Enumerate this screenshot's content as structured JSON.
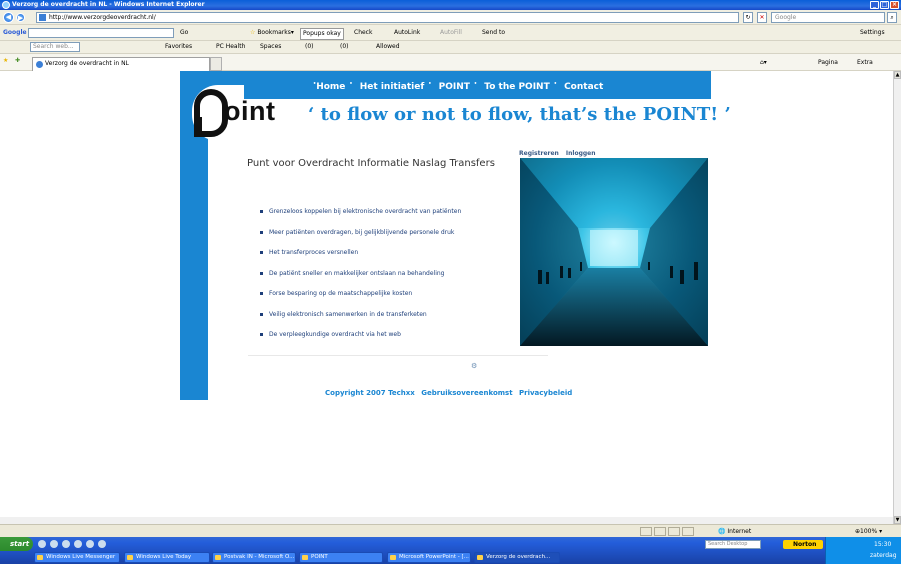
{
  "window": {
    "title": "Verzorg de overdracht in NL - Windows Internet Explorer"
  },
  "address": {
    "url": "http://www.verzorgdeoverdracht.nl/",
    "search_placeholder": "Google"
  },
  "toolbar": {
    "google": "Google",
    "search_placeholder": "Search web...",
    "go": "Go",
    "bookmarks": "Bookmarks",
    "popups": "Popups okay",
    "check": "Check",
    "autolink": "AutoLink",
    "autofill": "AutoFill",
    "sendto": "Send to",
    "settings": "Settings"
  },
  "toolbar2": {
    "search_placeholder": "Search web...",
    "favorites": "Favorites",
    "pchealth": "PC Health",
    "spaces": "Spaces",
    "mail_count": "(0)",
    "msg_count": "(0)",
    "allowed": "Allowed"
  },
  "tabs": {
    "active_label": "Verzorg de overdracht in NL",
    "page": "Pagina",
    "extra": "Extra"
  },
  "site": {
    "nav": [
      {
        "label": "Home"
      },
      {
        "label": "Het initiatief"
      },
      {
        "label": "POINT"
      },
      {
        "label": "To the POINT"
      },
      {
        "label": "Contact"
      }
    ],
    "logo_text": "oint",
    "slogan": "‘ to flow or not to flow, that’s the POINT! ’",
    "title": "Punt voor Overdracht Informatie Naslag Transfers",
    "register": "Registreren",
    "login": "Inloggen",
    "bullets": [
      "Grenzeloos koppelen bij elektronische overdracht van patiënten",
      "Meer patiënten overdragen, bij gelijkblijvende personele druk",
      "Het transferproces versnellen",
      "De patiënt sneller en makkelijker ontslaan na behandeling",
      "Forse besparing op de maatschappelijke kosten",
      "Veilig elektronisch samenwerken in de transferketen",
      "De verpleegkundige overdracht via het web"
    ],
    "footer": {
      "copyright": "Copyright 2007 Techxx",
      "terms": "Gebruiksovereenkomst",
      "privacy": "Privacybeleid"
    }
  },
  "status": {
    "zone": "Internet",
    "zoom": "100%"
  },
  "taskbar": {
    "start": "start",
    "desktop_search": "Search Desktop",
    "norton": "Norton",
    "time": "15:30",
    "day": "zaterdag",
    "buttons": [
      "Windows Live Messenger",
      "Windows Live Today",
      "Postvak IN - Microsoft O...",
      "POINT",
      "Microsoft PowerPoint - [...",
      "Verzorg de overdrach..."
    ]
  },
  "colors": {
    "brand_blue": "#1a86d2",
    "text_blue": "#1e3f7a"
  }
}
